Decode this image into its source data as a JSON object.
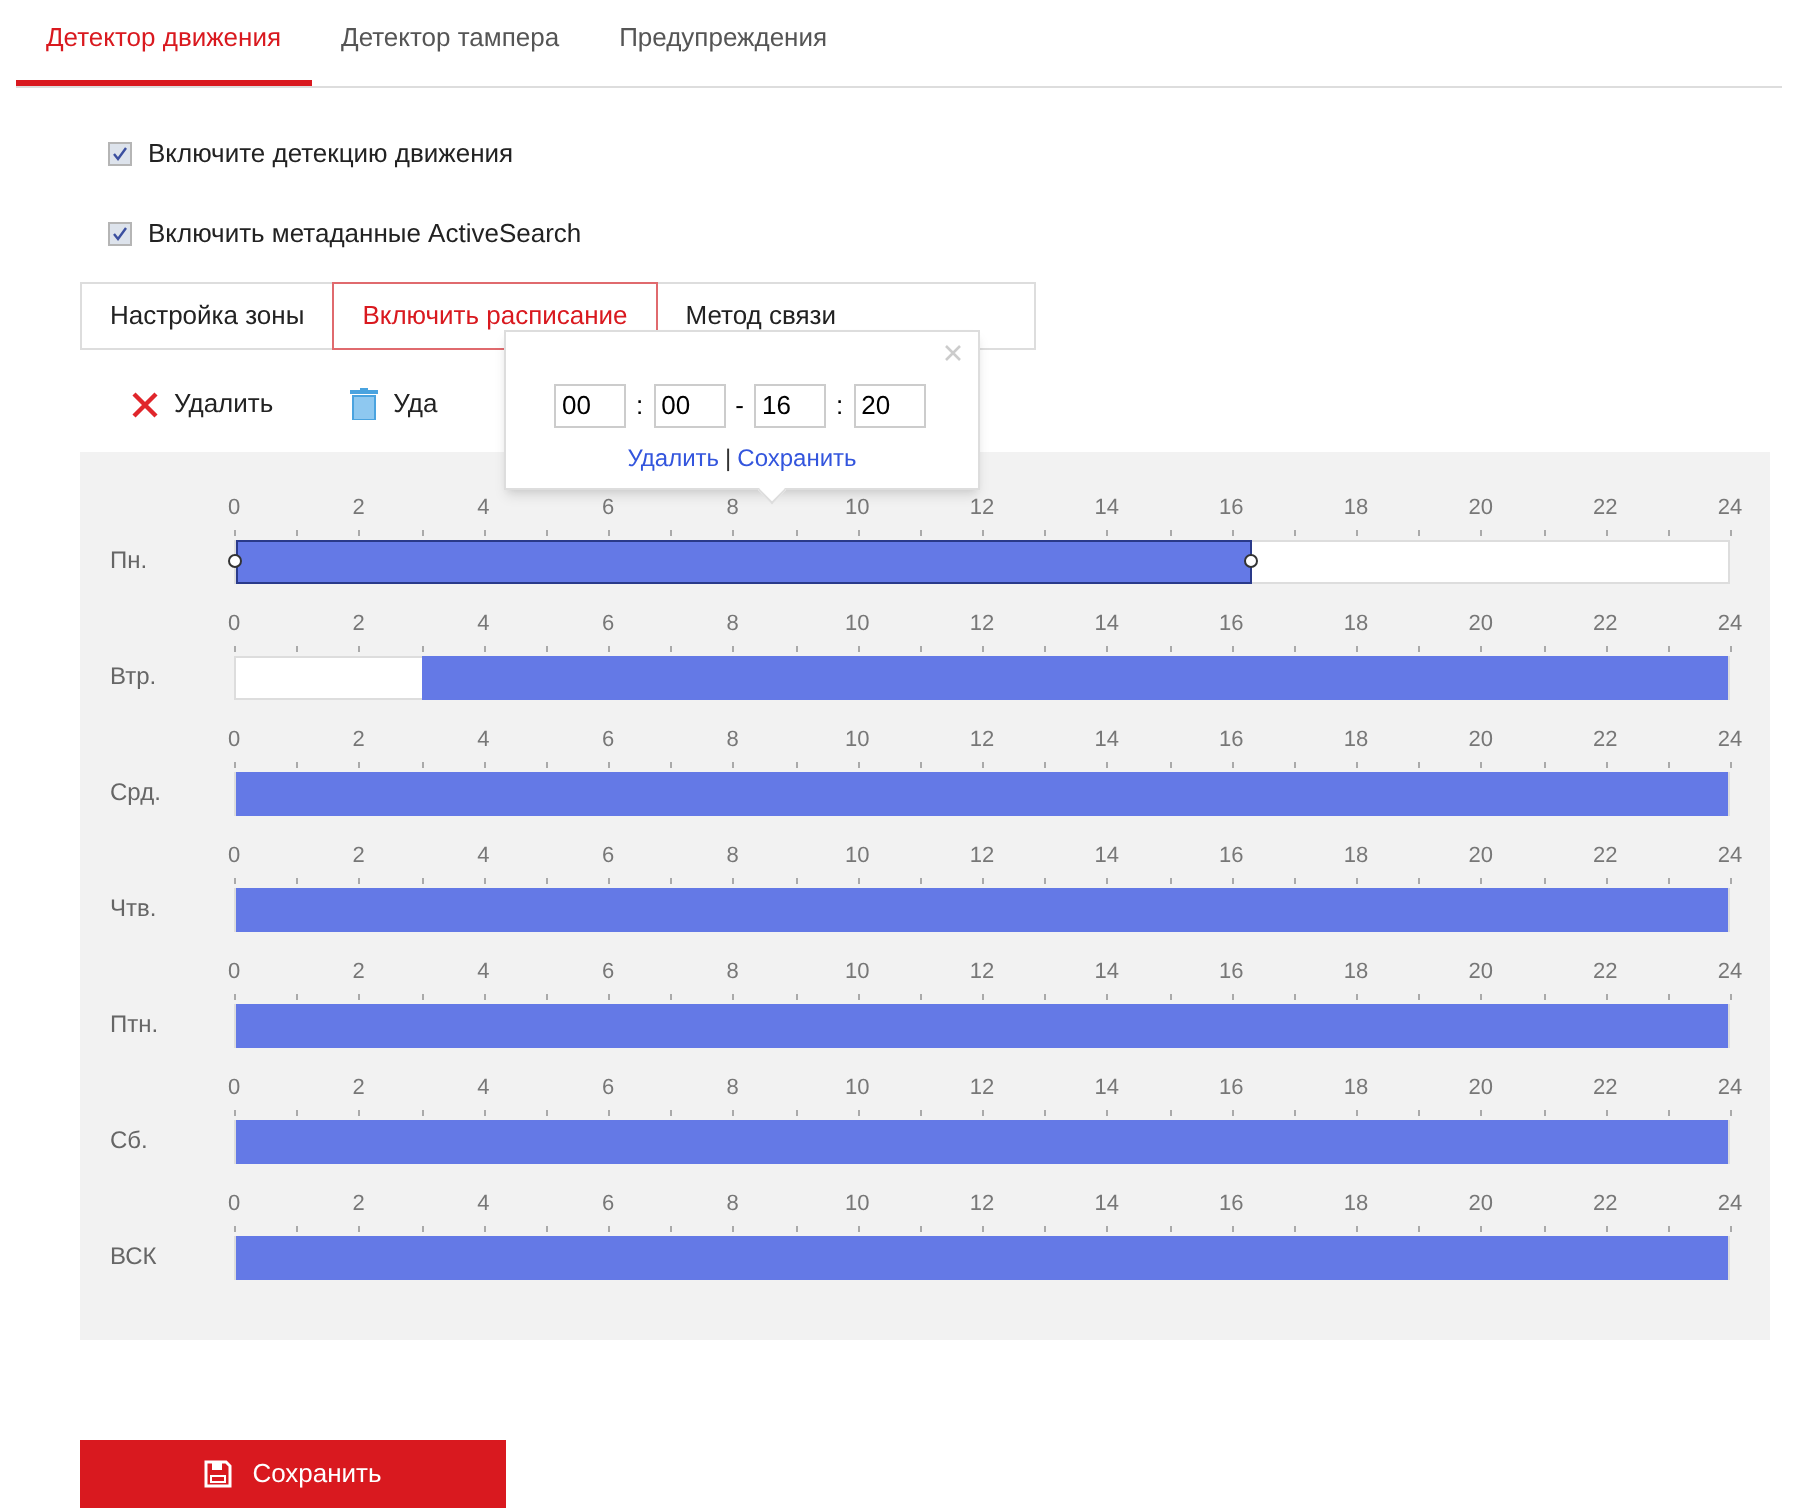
{
  "tabs": [
    {
      "label": "Детектор движения",
      "selected": true
    },
    {
      "label": "Детектор тампера",
      "selected": false
    },
    {
      "label": "Предупреждения",
      "selected": false
    }
  ],
  "checkboxes": [
    {
      "label": "Включите детекцию движения",
      "checked": true
    },
    {
      "label": "Включить метаданные ActiveSearch",
      "checked": true
    }
  ],
  "steps": [
    {
      "label": "Настройка зоны",
      "selected": false
    },
    {
      "label": "Включить расписание",
      "selected": true
    },
    {
      "label": "Метод связи",
      "selected": false
    }
  ],
  "toolbar": [
    {
      "kind": "delete",
      "label": "Удалить"
    },
    {
      "kind": "delete-all",
      "label": "Уда"
    }
  ],
  "popup": {
    "start_hour": "00",
    "start_minute": "00",
    "colon": ":",
    "separator": "-",
    "end_hour": "16",
    "end_minute": "20",
    "delete_link": "Удалить",
    "divider": "|",
    "save_link": "Сохранить"
  },
  "days": [
    {
      "label": "Пн.",
      "ticks": [
        "0",
        "2",
        "4",
        "6",
        "8",
        "10",
        "12",
        "14",
        "16",
        "18",
        "20",
        "22",
        "24"
      ],
      "kind": "from-start",
      "level": 0.6806,
      "selected": true
    },
    {
      "label": "Втр.",
      "ticks": [
        "0",
        "2",
        "4",
        "6",
        "8",
        "10",
        "12",
        "14",
        "16",
        "18",
        "20",
        "22",
        "24"
      ],
      "kind": "from-end",
      "level": 0.875,
      "selected": false
    },
    {
      "label": "Срд.",
      "ticks": [
        "0",
        "2",
        "4",
        "6",
        "8",
        "10",
        "12",
        "14",
        "16",
        "18",
        "20",
        "22",
        "24"
      ],
      "kind": "from-start",
      "level": 1,
      "selected": false
    },
    {
      "label": "Чтв.",
      "ticks": [
        "0",
        "2",
        "4",
        "6",
        "8",
        "10",
        "12",
        "14",
        "16",
        "18",
        "20",
        "22",
        "24"
      ],
      "kind": "from-start",
      "level": 1,
      "selected": false
    },
    {
      "label": "Птн.",
      "ticks": [
        "0",
        "2",
        "4",
        "6",
        "8",
        "10",
        "12",
        "14",
        "16",
        "18",
        "20",
        "22",
        "24"
      ],
      "kind": "from-start",
      "level": 1,
      "selected": false
    },
    {
      "label": "Сб.",
      "ticks": [
        "0",
        "2",
        "4",
        "6",
        "8",
        "10",
        "12",
        "14",
        "16",
        "18",
        "20",
        "22",
        "24"
      ],
      "kind": "from-start",
      "level": 1,
      "selected": false
    },
    {
      "label": "ВСК",
      "ticks": [
        "0",
        "2",
        "4",
        "6",
        "8",
        "10",
        "12",
        "14",
        "16",
        "18",
        "20",
        "22",
        "24"
      ],
      "kind": "from-start",
      "level": 1,
      "selected": false
    }
  ],
  "save_button": "Сохранить"
}
